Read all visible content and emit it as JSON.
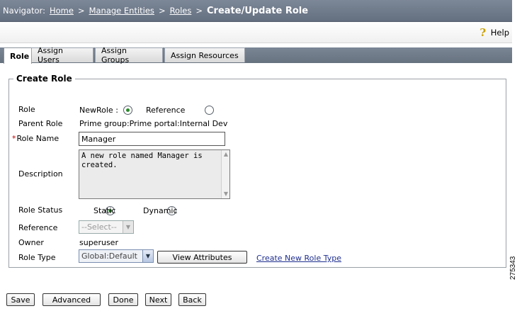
{
  "nav": {
    "label": "Navigator:",
    "crumbs": [
      "Home",
      "Manage Entities",
      "Roles"
    ],
    "current": "Create/Update Role"
  },
  "help": {
    "label": "Help"
  },
  "tabs": [
    {
      "label": "Role",
      "active": true
    },
    {
      "label": "Assign Users",
      "active": false
    },
    {
      "label": "Assign Groups",
      "active": false
    },
    {
      "label": "Assign Resources",
      "active": false
    }
  ],
  "form": {
    "legend": "Create Role",
    "role_label": "Role",
    "newrole_option": "NewRole :",
    "reference_option": "Reference",
    "parent_role_label": "Parent Role",
    "parent_role_value": "Prime group:Prime portal:Internal Dev",
    "required_marker": "*",
    "role_name_label": "Role Name",
    "role_name_value": "Manager",
    "description_label": "Description",
    "description_value": "A new role named Manager is created.",
    "role_status_label": "Role Status",
    "status_static": "Static",
    "status_dynamic": "Dynamic",
    "reference_label": "Reference",
    "reference_select": "--Select--",
    "owner_label": "Owner",
    "owner_value": "superuser",
    "role_type_label": "Role Type",
    "role_type_select": "Global:Default",
    "view_attributes_button": "View Attributes",
    "create_role_type_link": "Create New Role Type"
  },
  "actions": {
    "save": "Save",
    "advanced": "Advanced",
    "done": "Done",
    "next": "Next",
    "back": "Back"
  },
  "figure_id": "275343",
  "colors": {
    "header_bg": "#6f7a8a",
    "radio_selected": "#2c8a2c",
    "required": "#c00000",
    "link": "#1f2f8f"
  }
}
